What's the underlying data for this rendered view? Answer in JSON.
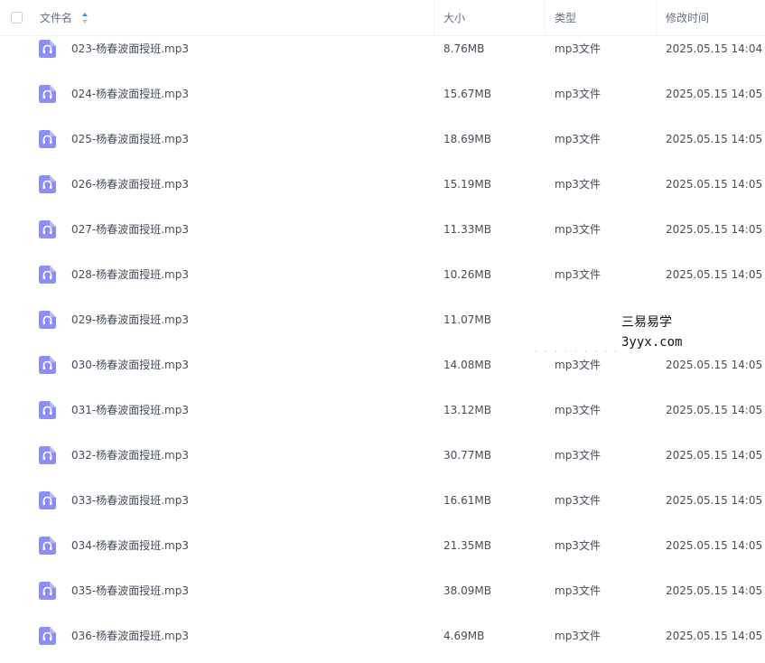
{
  "header": {
    "name_label": "文件名",
    "size_label": "大小",
    "type_label": "类型",
    "date_label": "修改时间"
  },
  "files": [
    {
      "name": "023-杨春波面授班.mp3",
      "size": "8.76MB",
      "type": "mp3文件",
      "date": "2025.05.15 14:04"
    },
    {
      "name": "024-杨春波面授班.mp3",
      "size": "15.67MB",
      "type": "mp3文件",
      "date": "2025.05.15 14:05"
    },
    {
      "name": "025-杨春波面授班.mp3",
      "size": "18.69MB",
      "type": "mp3文件",
      "date": "2025.05.15 14:05"
    },
    {
      "name": "026-杨春波面授班.mp3",
      "size": "15.19MB",
      "type": "mp3文件",
      "date": "2025.05.15 14:05"
    },
    {
      "name": "027-杨春波面授班.mp3",
      "size": "11.33MB",
      "type": "mp3文件",
      "date": "2025.05.15 14:05"
    },
    {
      "name": "028-杨春波面授班.mp3",
      "size": "10.26MB",
      "type": "mp3文件",
      "date": "2025.05.15 14:05"
    },
    {
      "name": "029-杨春波面授班.mp3",
      "size": "11.07MB",
      "type": "",
      "date": ""
    },
    {
      "name": "030-杨春波面授班.mp3",
      "size": "14.08MB",
      "type": "mp3文件",
      "date": "2025.05.15 14:05"
    },
    {
      "name": "031-杨春波面授班.mp3",
      "size": "13.12MB",
      "type": "mp3文件",
      "date": "2025.05.15 14:05"
    },
    {
      "name": "032-杨春波面授班.mp3",
      "size": "30.77MB",
      "type": "mp3文件",
      "date": "2025.05.15 14:05"
    },
    {
      "name": "033-杨春波面授班.mp3",
      "size": "16.61MB",
      "type": "mp3文件",
      "date": "2025.05.15 14:05"
    },
    {
      "name": "034-杨春波面授班.mp3",
      "size": "21.35MB",
      "type": "mp3文件",
      "date": "2025.05.15 14:05"
    },
    {
      "name": "035-杨春波面授班.mp3",
      "size": "38.09MB",
      "type": "mp3文件",
      "date": "2025.05.15 14:05"
    },
    {
      "name": "036-杨春波面授班.mp3",
      "size": "4.69MB",
      "type": "mp3文件",
      "date": "2025.05.15 14:05"
    }
  ],
  "watermark": {
    "line1": "三易易学",
    "line2": "3yyx.com"
  },
  "icons": {
    "file_icon": "audio-file-icon",
    "sort_icon": "sort-icon"
  },
  "colors": {
    "file_icon": "#8c8ef8",
    "sort_active": "#06a7ff",
    "sort_inactive": "#c2c6cc",
    "text": "#454d5a"
  }
}
